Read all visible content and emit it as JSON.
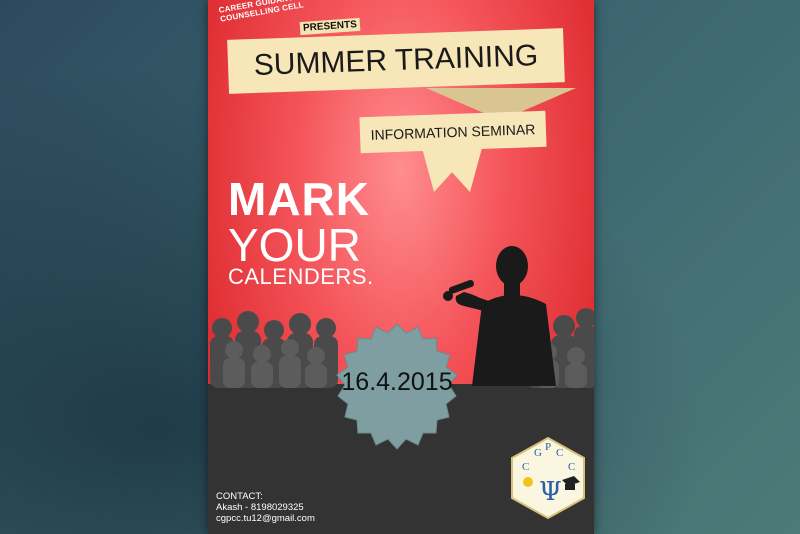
{
  "poster": {
    "organizer": "CAREER GUIDANCE & PERSONAL COUNSELLING CELL",
    "presents": "PRESENTS",
    "title": "SUMMER TRAINING",
    "subtitle": "INFORMATION SEMINAR",
    "headline": {
      "line1": "MARK",
      "line2": "YOUR",
      "line3": "CALENDERS."
    },
    "date": "16.4.2015",
    "contact": {
      "heading": "CONTACT:",
      "person": "Akash - 8198029325",
      "email": "cgpcc.tu12@gmail.com"
    },
    "logo": {
      "letters": [
        "C",
        "G",
        "P",
        "C",
        "C"
      ],
      "symbol": "Ψ"
    }
  },
  "colors": {
    "poster_red": "#e03035",
    "ribbon": "#f7e6b8",
    "band": "#333333",
    "seal": "#7e9ea1",
    "background": "#3b6470"
  }
}
